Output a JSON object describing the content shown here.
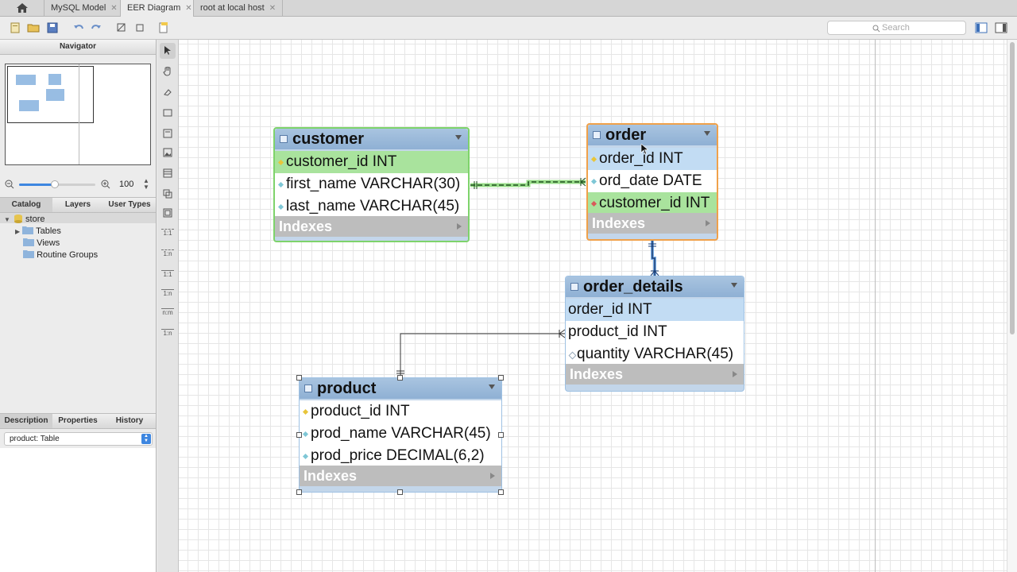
{
  "tabs": [
    {
      "label": "MySQL Model"
    },
    {
      "label": "EER Diagram"
    },
    {
      "label": "root at local host"
    }
  ],
  "toolbar": {
    "search_placeholder": "Search"
  },
  "navigator": {
    "title": "Navigator",
    "zoom": "100"
  },
  "catalog": {
    "tabs": [
      "Catalog",
      "Layers",
      "User Types"
    ],
    "schema": "store",
    "items": [
      "Tables",
      "Views",
      "Routine Groups"
    ]
  },
  "description": {
    "tabs": [
      "Description",
      "Properties",
      "History"
    ],
    "selected": "product: Table"
  },
  "tools": [
    "1:1",
    "1:n",
    "1:1",
    "1:n",
    "n:m",
    "1:n"
  ],
  "tables": {
    "customer": {
      "name": "customer",
      "columns": [
        "customer_id INT",
        "first_name VARCHAR(30)",
        "last_name VARCHAR(45)"
      ],
      "indexes": "Indexes"
    },
    "order": {
      "name": "order",
      "columns": [
        "order_id INT",
        "ord_date DATE",
        "customer_id INT"
      ],
      "indexes": "Indexes"
    },
    "order_details": {
      "name": "order_details",
      "columns": [
        "order_id INT",
        "product_id INT",
        "quantity VARCHAR(45)"
      ],
      "indexes": "Indexes"
    },
    "product": {
      "name": "product",
      "columns": [
        "product_id INT",
        "prod_name VARCHAR(45)",
        "prod_price DECIMAL(6,2)"
      ],
      "indexes": "Indexes"
    }
  },
  "colors": {
    "table_header": "#8fb0d4",
    "pk_row": "#c2dcf3",
    "fk_row_highlight": "#a9e39d",
    "selected_outline_green": "#7ed36b",
    "selected_outline_orange": "#f0a14a",
    "relationship_highlight": "#3aa63a"
  }
}
